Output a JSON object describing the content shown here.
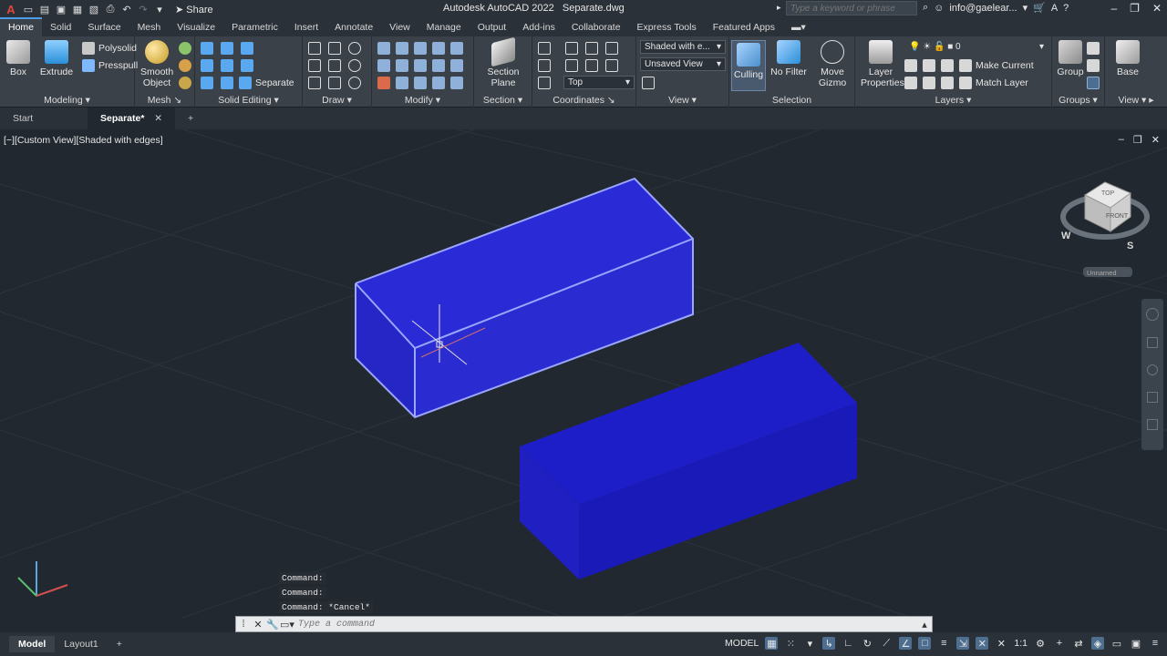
{
  "app": {
    "title": "Autodesk AutoCAD 2022",
    "document": "Separate.dwg",
    "share_label": "Share",
    "search_placeholder": "Type a keyword or phrase",
    "user": "info@gaelear..."
  },
  "ribbon_tabs": [
    "Home",
    "Solid",
    "Surface",
    "Mesh",
    "Visualize",
    "Parametric",
    "Insert",
    "Annotate",
    "View",
    "Manage",
    "Output",
    "Add-ins",
    "Collaborate",
    "Express Tools",
    "Featured Apps"
  ],
  "panels": {
    "modeling": {
      "title": "Modeling",
      "box": "Box",
      "extrude": "Extrude",
      "polysolid": "Polysolid",
      "presspull": "Presspull"
    },
    "mesh": {
      "title": "Mesh",
      "smooth_object": "Smooth Object"
    },
    "solid_editing": {
      "title": "Solid Editing",
      "separate": "Separate"
    },
    "draw": {
      "title": "Draw"
    },
    "modify": {
      "title": "Modify"
    },
    "section": {
      "title": "Section",
      "section_plane": "Section Plane"
    },
    "coordinates": {
      "title": "Coordinates",
      "ucs_value": "Top"
    },
    "view": {
      "title": "View",
      "visual_style": "Shaded with e...",
      "named_view": "Unsaved View"
    },
    "selection": {
      "title": "Selection",
      "culling": "Culling",
      "no_filter": "No Filter",
      "move_gizmo": "Move Gizmo"
    },
    "layers": {
      "title": "Layers",
      "layer_properties": "Layer Properties",
      "layer_value": "0",
      "make_current": "Make Current",
      "match_layer": "Match Layer"
    },
    "groups": {
      "title": "Groups",
      "group": "Group"
    },
    "view2": {
      "title": "View",
      "base": "Base"
    }
  },
  "doc_tabs": {
    "start": "Start",
    "active": "Separate*"
  },
  "viewport": {
    "label": "[−][Custom View][Shaded with edges]",
    "viewcube": {
      "top": "TOP",
      "front": "FRONT",
      "west": "W",
      "south": "S",
      "ucs_label": "Unnamed"
    }
  },
  "command": {
    "history": [
      "Command:",
      "Command:",
      "Command: *Cancel*"
    ],
    "placeholder": "Type a command"
  },
  "status": {
    "model_tab": "Model",
    "layout_tab": "Layout1",
    "model_label": "MODEL",
    "scale": "1:1"
  },
  "colors": {
    "box_top": "#2a2bd6",
    "box_front": "#1c1cc4",
    "box_side": "#2424c8",
    "selection_edge": "#9aa6ff"
  }
}
